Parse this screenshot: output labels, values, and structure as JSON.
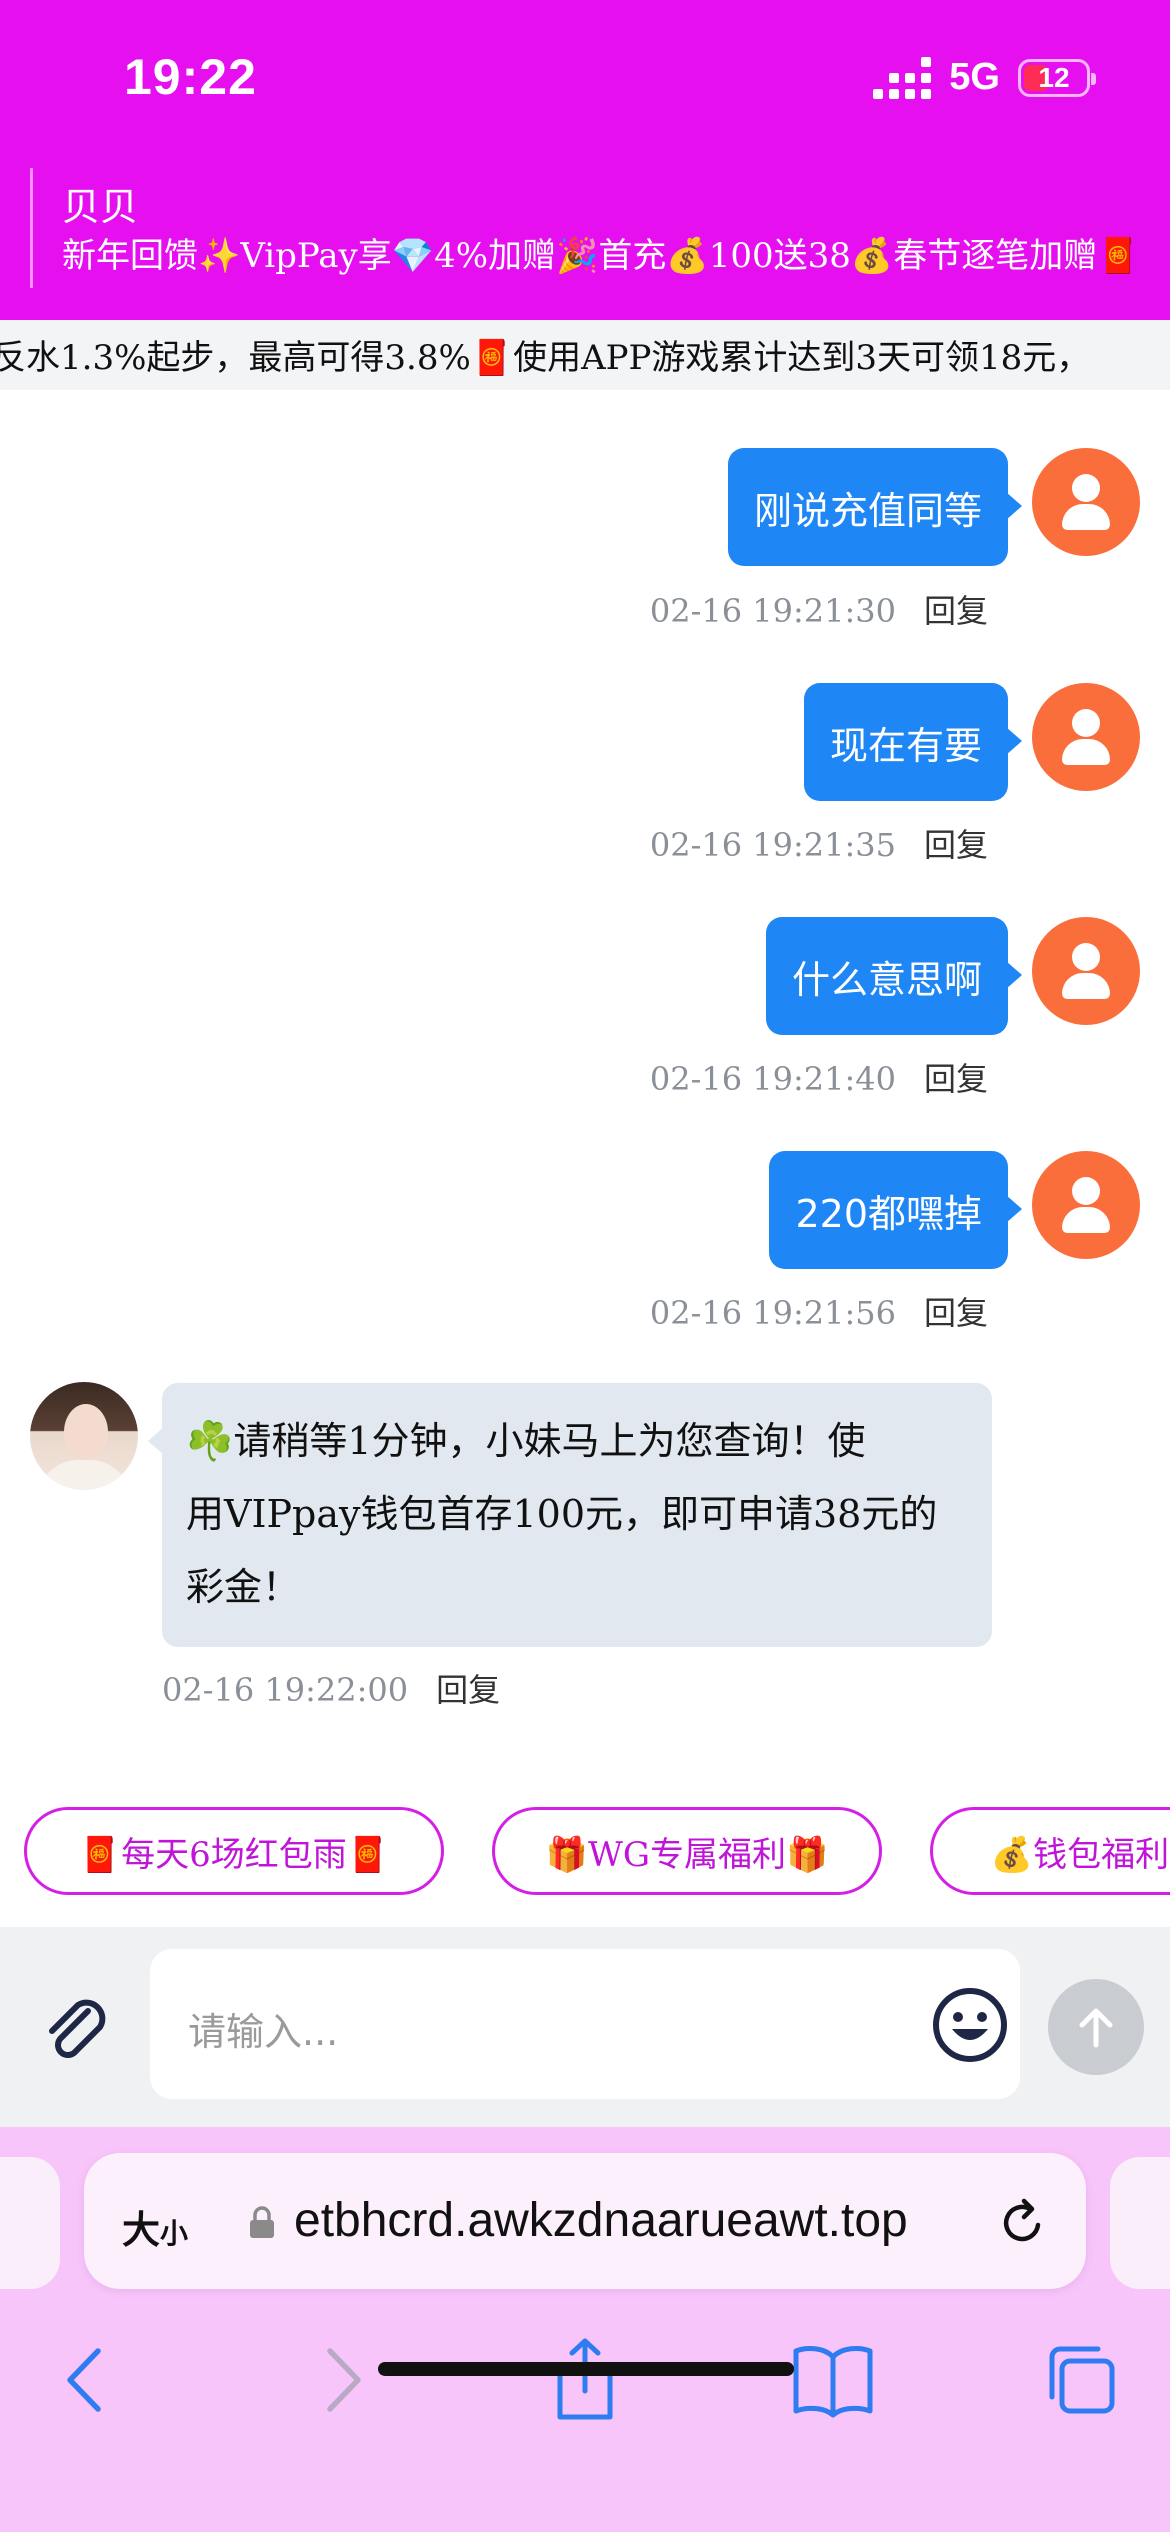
{
  "status": {
    "time": "19:22",
    "network": "5G",
    "battery": "12"
  },
  "header": {
    "room_name": "贝贝",
    "notice": "新年回馈✨VipPay享💎4%加赠🎉首充💰100送38💰春节逐笔加赠🧧"
  },
  "marquee": {
    "text": "反水1.3%起步，最高可得3.8%🧧使用APP游戏累计达到3天可领18元，"
  },
  "messages_out": [
    {
      "text": "刚说充值同等",
      "time": "02-16 19:21:30",
      "reply": "回复"
    },
    {
      "text": "现在有要",
      "time": "02-16 19:21:35",
      "reply": "回复"
    },
    {
      "text": "什么意思啊",
      "time": "02-16 19:21:40",
      "reply": "回复"
    },
    {
      "text": "220都嘿掉",
      "time": "02-16 19:21:56",
      "reply": "回复"
    }
  ],
  "message_in": {
    "line1": "☘️请稍等1分钟，小妹马上为您查询！使",
    "line2": "用VIPpay钱包首存100元，即可申请38元的",
    "line3": "彩金！",
    "time": "02-16 19:22:00",
    "reply": "回复"
  },
  "quick_replies": [
    "🧧每天6场红包雨🧧",
    "🎁WG专属福利🎁",
    "💰钱包福利"
  ],
  "composer": {
    "placeholder": "请输入..."
  },
  "safari": {
    "text_size": "大",
    "text_size_small": "小",
    "url": "etbhcrd.awkzdnaarueawt.top"
  },
  "colors": {
    "header": "#e60ff0",
    "bubble_out": "#1f86f5",
    "bubble_in": "#e2e8f0",
    "safari_bar": "#f7c5f9",
    "chip": "#d51fe6"
  },
  "icons": [
    "signal-icon",
    "battery-icon",
    "user-icon",
    "paperclip-icon",
    "emoji-icon",
    "send-arrow-icon",
    "lock-icon",
    "reload-icon",
    "back-icon",
    "forward-icon",
    "share-icon",
    "bookmarks-icon",
    "tabs-icon"
  ]
}
